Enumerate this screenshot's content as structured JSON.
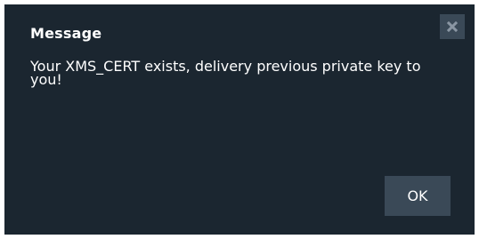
{
  "dialog": {
    "title": "Message",
    "message": "Your XMS_CERT exists, delivery previous private key to you!",
    "ok_label": "OK",
    "close_icon": "close-icon"
  },
  "colors": {
    "dialog_background": "#1b2630",
    "button_background": "#3a4957",
    "text": "#ffffff",
    "close_glyph": "#8a96a3"
  }
}
